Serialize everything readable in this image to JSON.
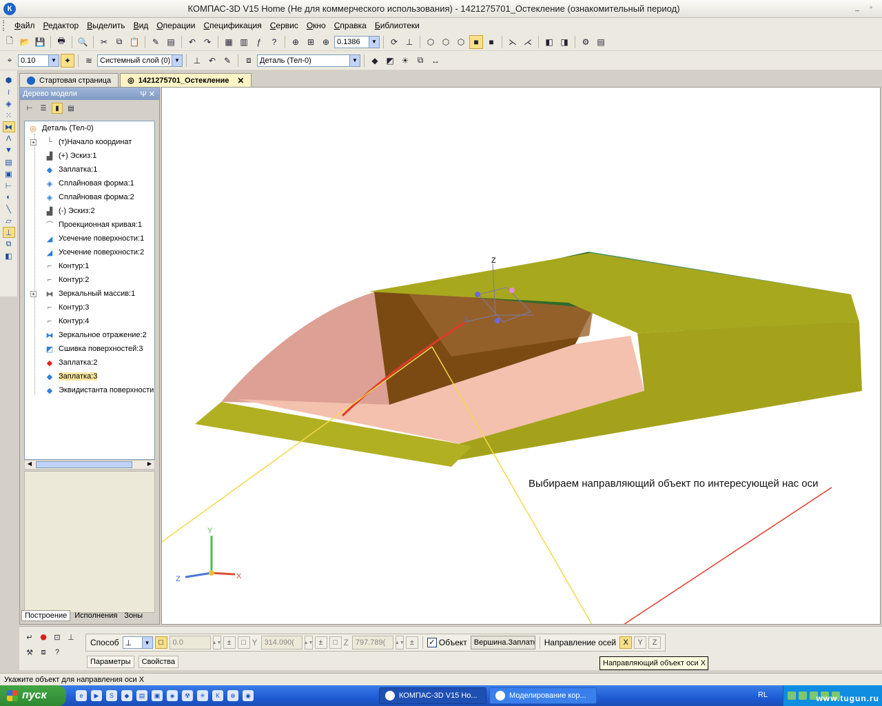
{
  "window": {
    "title": "КОМПАС-3D V15 Home (Не для коммерческого использования) - 1421275701_Остекление (ознакомительный период)",
    "app_icon": "К",
    "min": "_",
    "max": "▫",
    "close": "✕"
  },
  "menu": [
    "Файл",
    "Редактор",
    "Выделить",
    "Вид",
    "Операции",
    "Спецификация",
    "Сервис",
    "Окно",
    "Справка",
    "Библиотеки"
  ],
  "toolbar1": {
    "zoom_value": "0.1386"
  },
  "toolbar2": {
    "step_value": "0.10",
    "layer_value": "Системный слой (0)",
    "detail_value": "Деталь (Тел-0)"
  },
  "tabs": [
    {
      "label": "Стартовая страница",
      "active": false
    },
    {
      "label": "1421275701_Остекление",
      "active": true
    }
  ],
  "tree_panel": {
    "title": "Дерево модели",
    "pin": "Ψ ✕",
    "items": [
      {
        "label": "Деталь (Тел-0)",
        "icon": "part-icon",
        "glyph": "◎",
        "color": "#b8860b"
      },
      {
        "label": "(т)Начало координат",
        "icon": "origin-icon",
        "glyph": "└",
        "color": "#666666",
        "expander": "+"
      },
      {
        "label": "(+) Эскиз:1",
        "icon": "sketch-icon",
        "glyph": "▟",
        "color": "#555555"
      },
      {
        "label": "Заплатка:1",
        "icon": "patch-icon",
        "glyph": "◆",
        "color": "#2f7fd6"
      },
      {
        "label": "Сплайновая форма:1",
        "icon": "spline-form-icon",
        "glyph": "◈",
        "color": "#2f7fd6"
      },
      {
        "label": "Сплайновая форма:2",
        "icon": "spline-form-icon",
        "glyph": "◈",
        "color": "#2f7fd6"
      },
      {
        "label": "(-) Эскиз:2",
        "icon": "sketch-icon",
        "glyph": "▟",
        "color": "#555555"
      },
      {
        "label": "Проекционная кривая:1",
        "icon": "projection-curve-icon",
        "glyph": "⌒",
        "color": "#777777"
      },
      {
        "label": "Усечение поверхности:1",
        "icon": "trim-surface-icon",
        "glyph": "◢",
        "color": "#2f7fd6"
      },
      {
        "label": "Усечение поверхности:2",
        "icon": "trim-surface-icon",
        "glyph": "◢",
        "color": "#2f7fd6"
      },
      {
        "label": "Контур:1",
        "icon": "contour-icon",
        "glyph": "⌐",
        "color": "#666666"
      },
      {
        "label": "Контур:2",
        "icon": "contour-icon",
        "glyph": "⌐",
        "color": "#666666"
      },
      {
        "label": "Зеркальный массив:1",
        "icon": "mirror-array-icon",
        "glyph": "⧓",
        "color": "#666666",
        "expander": "+"
      },
      {
        "label": "Контур:3",
        "icon": "contour-icon",
        "glyph": "⌐",
        "color": "#666666"
      },
      {
        "label": "Контур:4",
        "icon": "contour-icon",
        "glyph": "⌐",
        "color": "#666666"
      },
      {
        "label": "Зеркальное отражение:2",
        "icon": "mirror-icon",
        "glyph": "⧓",
        "color": "#2f7fd6"
      },
      {
        "label": "Сшивка поверхностей:3",
        "icon": "stitch-icon",
        "glyph": "◩",
        "color": "#2f7fd6"
      },
      {
        "label": "Заплатка:2",
        "icon": "patch-icon",
        "glyph": "◆",
        "color": "#e02020"
      },
      {
        "label": "Заплатка:3",
        "icon": "patch-icon",
        "glyph": "◆",
        "color": "#2f7fd6",
        "selected": true
      },
      {
        "label": "Эквидистанта поверхности",
        "icon": "offset-surface-icon",
        "glyph": "◆",
        "color": "#2f7fd6"
      }
    ],
    "bottom_tabs": [
      {
        "label": "Построение",
        "active": true
      },
      {
        "label": "Исполнения",
        "active": false
      },
      {
        "label": "Зоны",
        "active": false
      }
    ]
  },
  "viewport": {
    "annotation": "Выбираем направляющий объект по интересующей нас оси",
    "axes": {
      "x": "X",
      "y": "Y",
      "z": "Z"
    }
  },
  "property_bar": {
    "method_label": "Способ",
    "x_value": "0.0",
    "y_label": "Y",
    "y_value": "314.090(",
    "z_label": "Z",
    "z_value": "797.789(",
    "object_label": "Объект",
    "object_value": "Вершина.Заплатк",
    "axes_direction_label": "Направление осей",
    "axis_x": "X",
    "axis_y": "Y",
    "axis_z": "Z",
    "tabs": [
      "Параметры",
      "Свойства"
    ],
    "tooltip": "Направляющий объект оси X"
  },
  "status": {
    "text": "Укажите объект для направления оси X"
  },
  "taskbar": {
    "start_label": "пуск",
    "tasks": [
      {
        "label": "КОМПАС-3D V15 Ho..."
      },
      {
        "label": "Моделирование кор..."
      }
    ],
    "lang": "RL",
    "watermark": "www.tugun.ru"
  },
  "colors": {
    "olive": "#a8a81e",
    "green_glass": "#2e7d32",
    "salmon": "#e8a090",
    "arrow_yellow": "#f5d84a",
    "arrow_red": "#e03a2a"
  }
}
